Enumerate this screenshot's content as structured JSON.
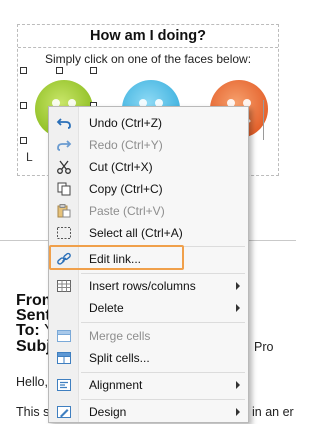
{
  "survey": {
    "title": "How am I doing?",
    "subtitle": "Simply click on one of the faces below:",
    "under_label": "L",
    "faces": [
      {
        "name": "happy",
        "color": "#a8cf3a"
      },
      {
        "name": "neutral",
        "color": "#5fc4e8"
      },
      {
        "name": "sad",
        "color": "#f07a3e"
      }
    ]
  },
  "email": {
    "from_label": "From",
    "sent_label": "Sent:",
    "to_label": "To:",
    "to_value": "Y",
    "subject_label": "Subje",
    "subject_tail": "Pro",
    "hello": "Hello,",
    "body_start": "This s",
    "body_tail": "in an er"
  },
  "context_menu": {
    "items": [
      {
        "id": "undo",
        "label": "Undo (Ctrl+Z)",
        "icon": "undo-icon",
        "enabled": true
      },
      {
        "id": "redo",
        "label": "Redo (Ctrl+Y)",
        "icon": "redo-icon",
        "enabled": false
      },
      {
        "id": "cut",
        "label": "Cut (Ctrl+X)",
        "icon": "scissors-icon",
        "enabled": true
      },
      {
        "id": "copy",
        "label": "Copy (Ctrl+C)",
        "icon": "copy-icon",
        "enabled": true
      },
      {
        "id": "paste",
        "label": "Paste (Ctrl+V)",
        "icon": "paste-icon",
        "enabled": false
      },
      {
        "id": "select-all",
        "label": "Select all (Ctrl+A)",
        "icon": "select-all-icon",
        "enabled": true
      },
      {
        "id": "edit-link",
        "label": "Edit link...",
        "icon": "link-icon",
        "enabled": true,
        "highlighted": true
      },
      {
        "id": "insert-rows-columns",
        "label": "Insert rows/columns",
        "icon": "table-grid-icon",
        "enabled": true,
        "submenu": true
      },
      {
        "id": "delete",
        "label": "Delete",
        "icon": "",
        "enabled": true,
        "submenu": true
      },
      {
        "id": "merge-cells",
        "label": "Merge cells",
        "icon": "merge-cells-icon",
        "enabled": false
      },
      {
        "id": "split-cells",
        "label": "Split cells...",
        "icon": "split-cells-icon",
        "enabled": true
      },
      {
        "id": "alignment",
        "label": "Alignment",
        "icon": "alignment-icon",
        "enabled": true,
        "submenu": true
      },
      {
        "id": "design",
        "label": "Design",
        "icon": "pen-icon",
        "enabled": true,
        "submenu": true
      }
    ],
    "highlight_color": "#f0a04b"
  }
}
